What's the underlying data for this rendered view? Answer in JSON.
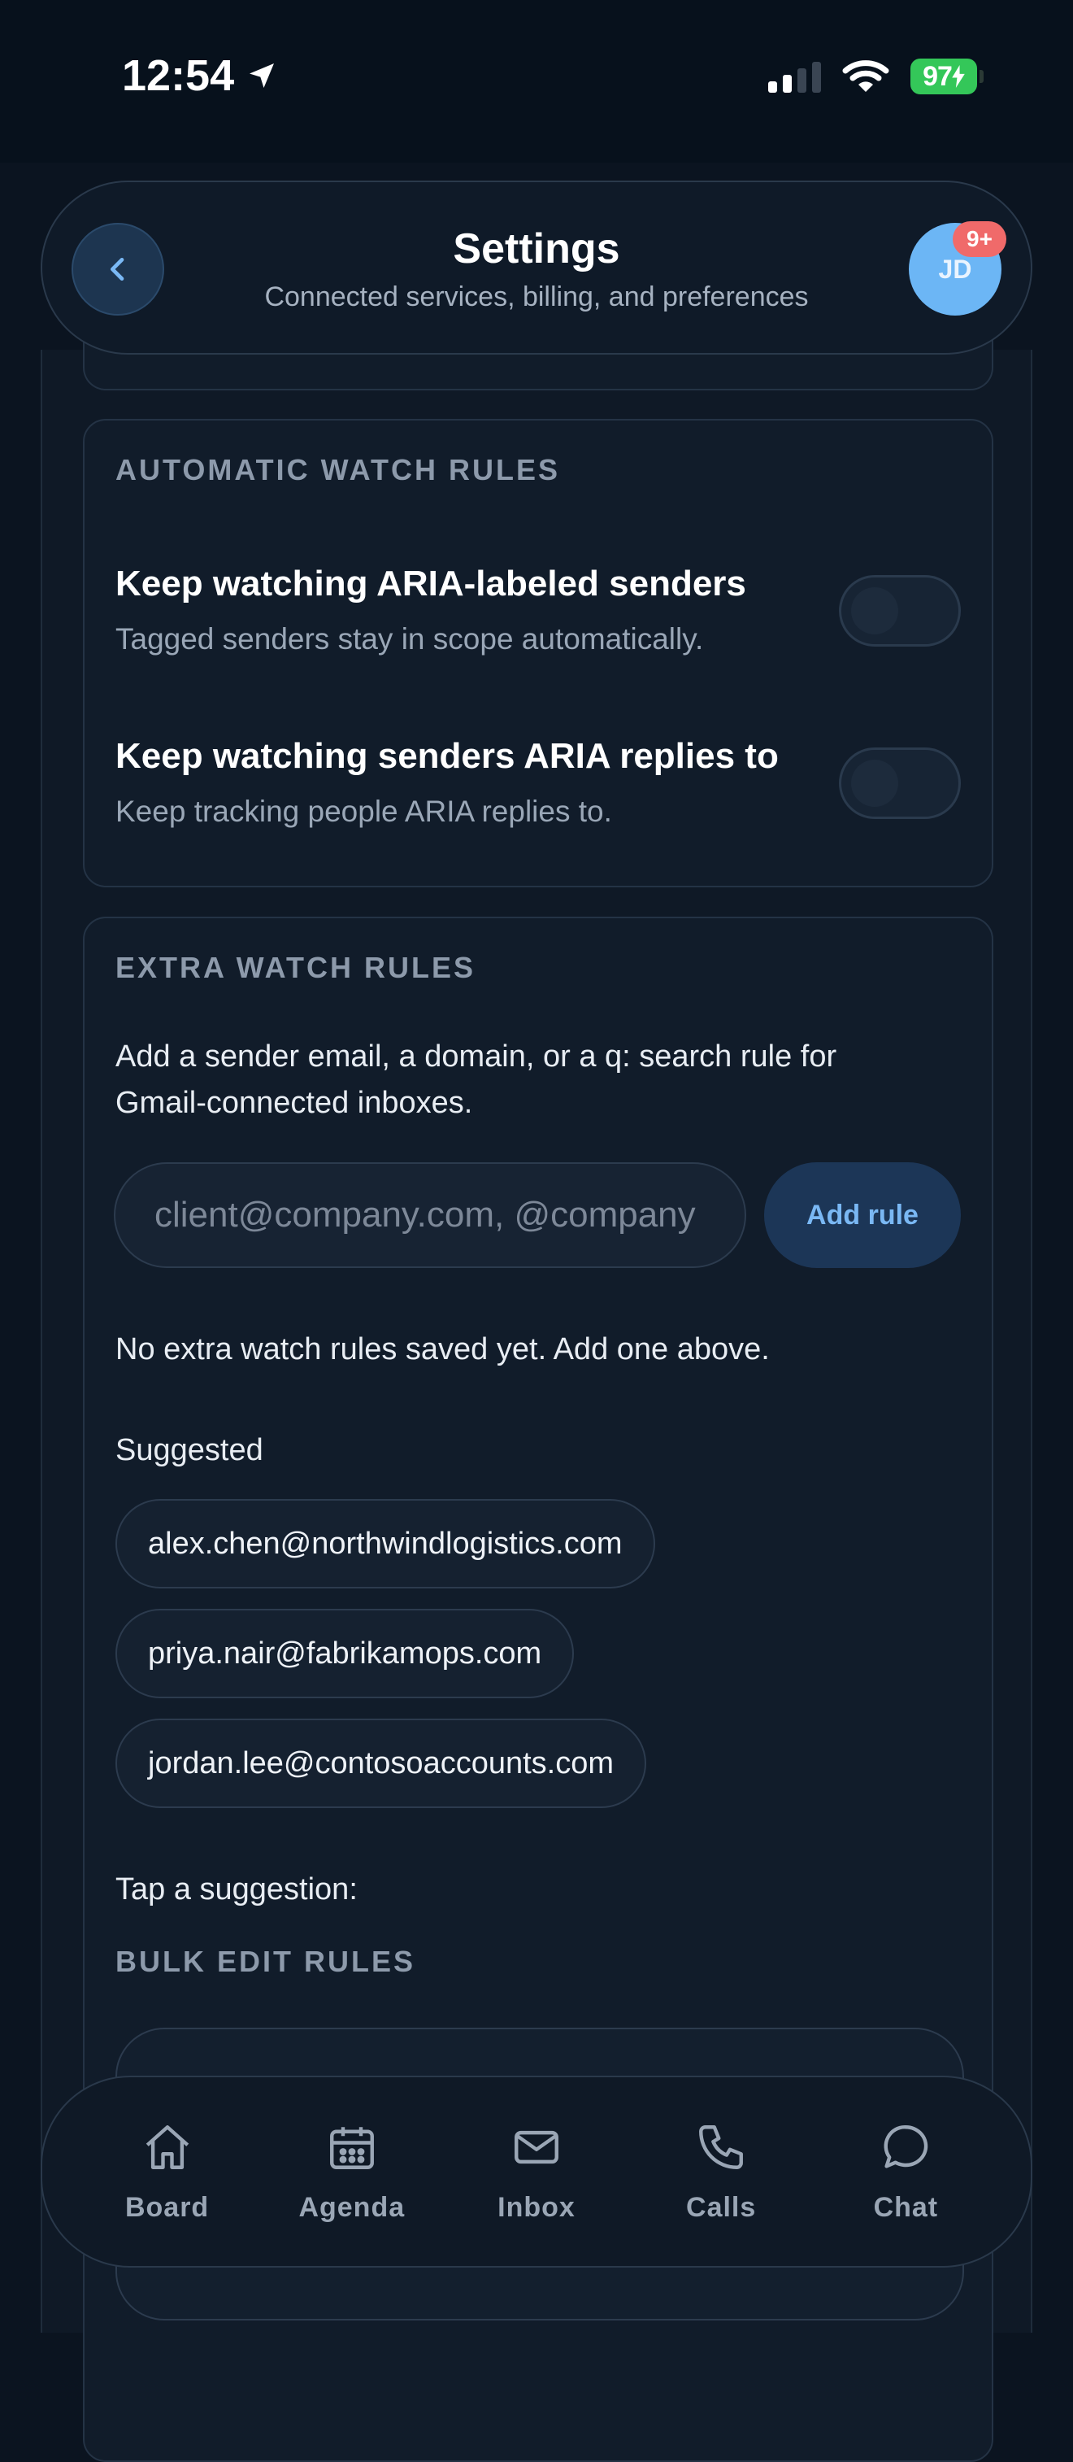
{
  "status_bar": {
    "time": "12:54",
    "battery": "97"
  },
  "header": {
    "title": "Settings",
    "subtitle": "Connected services, billing, and preferences",
    "avatar_initials": "JD",
    "notification_badge": "9+"
  },
  "automatic_rules": {
    "section_title": "AUTOMATIC WATCH RULES",
    "rules": [
      {
        "title": "Keep watching ARIA-labeled senders",
        "description": "Tagged senders stay in scope automatically.",
        "enabled": false
      },
      {
        "title": "Keep watching senders ARIA replies to",
        "description": "Keep tracking people ARIA replies to.",
        "enabled": false
      }
    ]
  },
  "extra_rules": {
    "section_title": "EXTRA WATCH RULES",
    "description": "Add a sender email, a domain, or a q: search rule for Gmail-connected inboxes.",
    "input_placeholder": "client@company.com, @company",
    "add_button_label": "Add rule",
    "empty_message": "No extra watch rules saved yet. Add one above.",
    "suggested_label": "Suggested",
    "suggestions": [
      "alex.chen@northwindlogistics.com",
      "priya.nair@fabrikamops.com",
      "jordan.lee@contosoaccounts.com"
    ],
    "tap_hint": "Tap a suggestion:",
    "bulk_edit_title": "BULK EDIT RULES"
  },
  "bottom_nav": {
    "items": [
      {
        "label": "Board",
        "icon": "home-icon"
      },
      {
        "label": "Agenda",
        "icon": "calendar-icon"
      },
      {
        "label": "Inbox",
        "icon": "mail-icon"
      },
      {
        "label": "Calls",
        "icon": "phone-icon"
      },
      {
        "label": "Chat",
        "icon": "chat-bubble-icon"
      }
    ]
  },
  "colors": {
    "background": "#0b1420",
    "card": "#111c2a",
    "accent": "#6cb6f5",
    "badge": "#f06a6a",
    "battery": "#34c759"
  }
}
